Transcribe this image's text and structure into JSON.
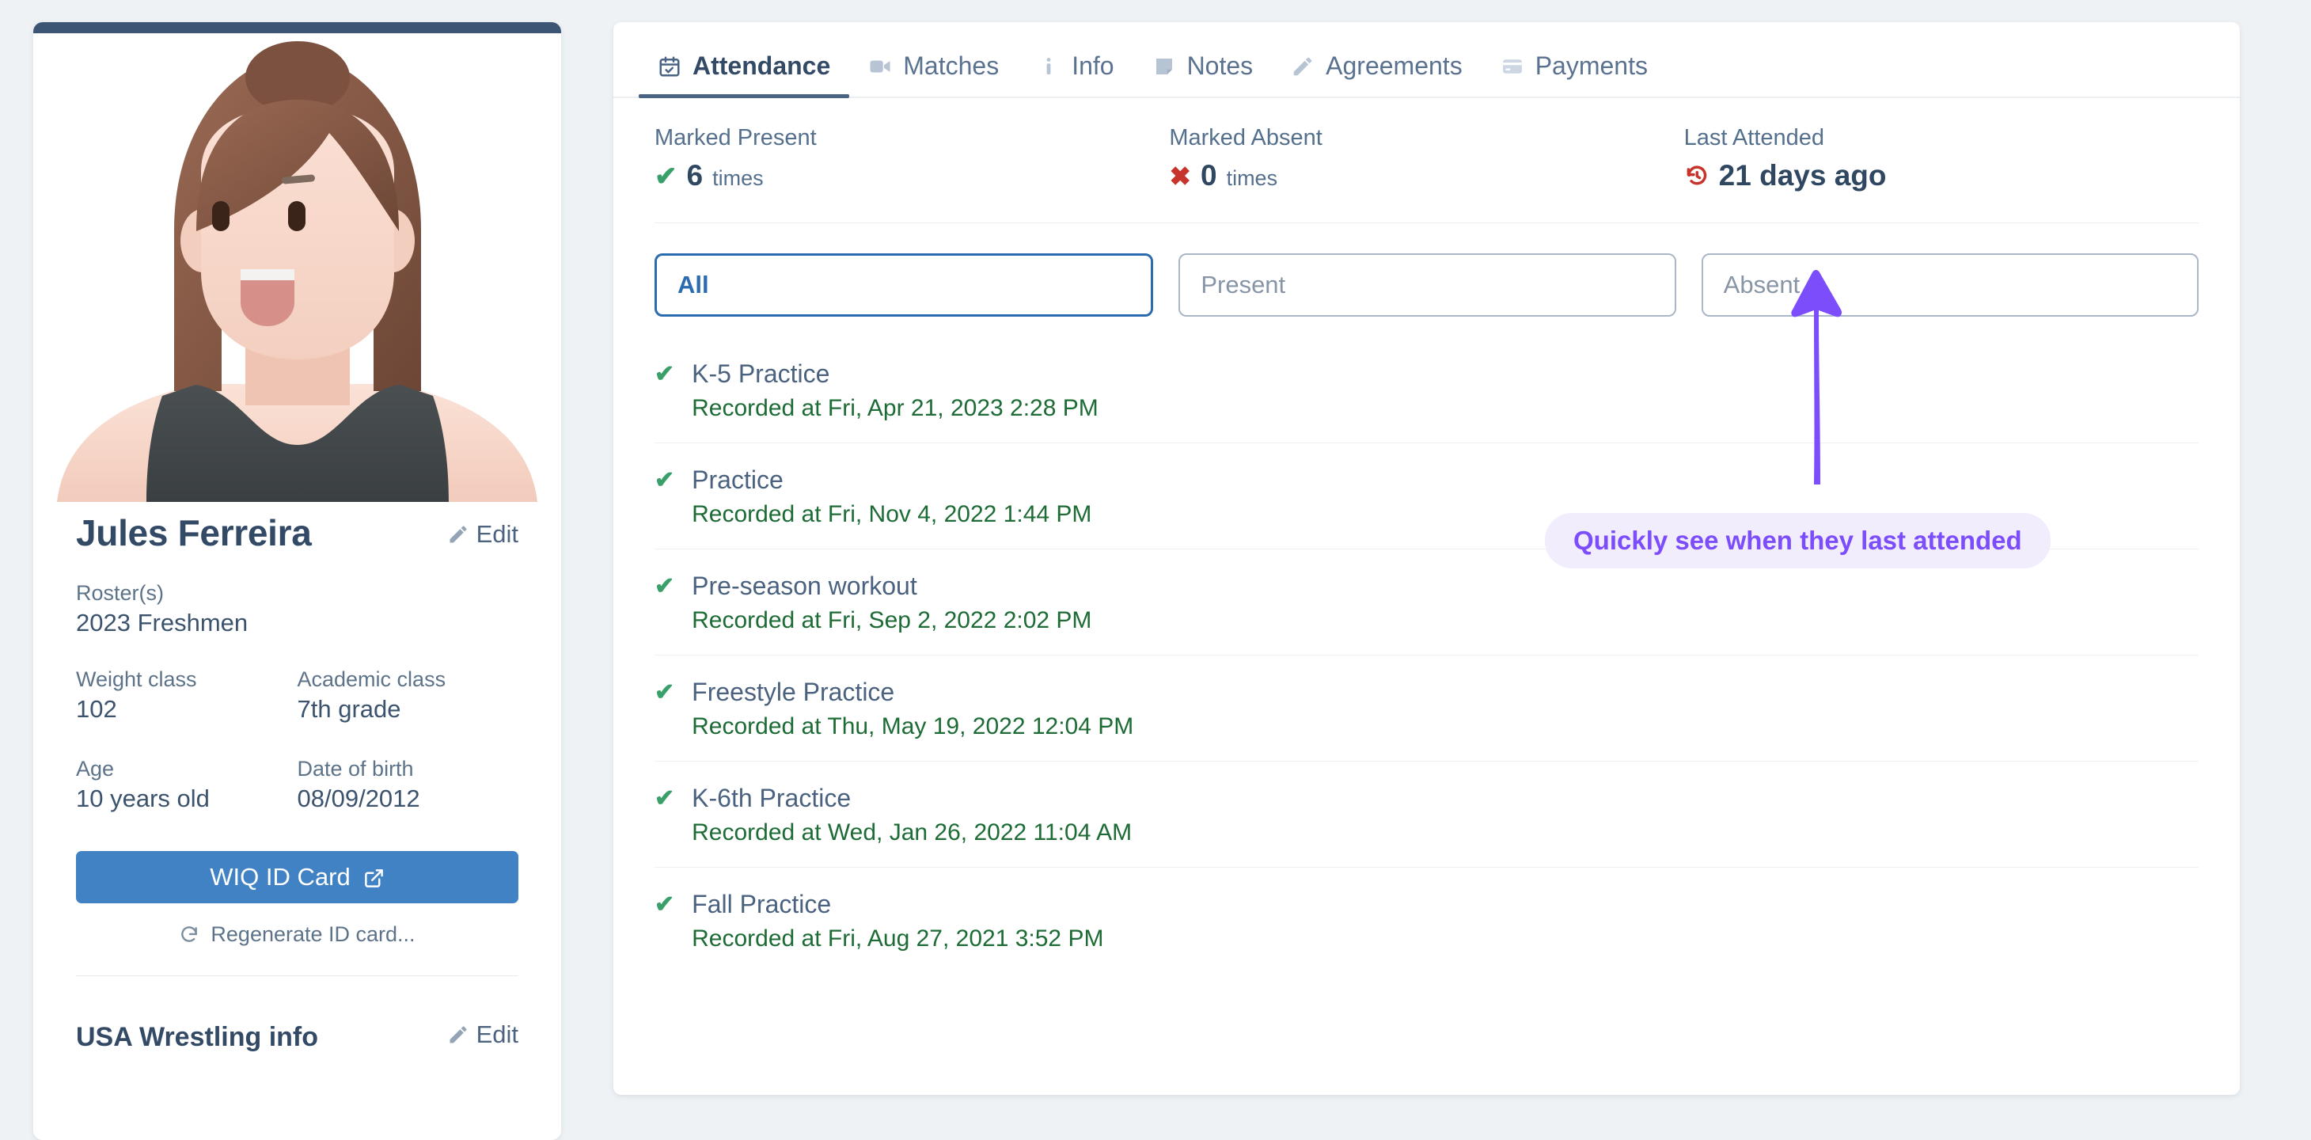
{
  "profile": {
    "name": "Jules Ferreira",
    "edit_label": "Edit",
    "avatar_alt": "female-wrestler-avatar",
    "roster_label": "Roster(s)",
    "roster_value": "2023 Freshmen",
    "weight_class_label": "Weight class",
    "weight_class_value": "102",
    "academic_class_label": "Academic class",
    "academic_class_value": "7th grade",
    "age_label": "Age",
    "age_value": "10 years old",
    "dob_label": "Date of birth",
    "dob_value": "08/09/2012",
    "wiq_button_label": "WIQ ID Card",
    "regenerate_label": "Regenerate ID card...",
    "usa_section_title": "USA Wrestling info",
    "usa_edit_label": "Edit"
  },
  "tabs": [
    {
      "label": "Attendance",
      "icon": "calendar-check-icon",
      "active": true
    },
    {
      "label": "Matches",
      "icon": "video-camera-icon",
      "active": false
    },
    {
      "label": "Info",
      "icon": "info-icon",
      "active": false
    },
    {
      "label": "Notes",
      "icon": "note-icon",
      "active": false
    },
    {
      "label": "Agreements",
      "icon": "pencil-icon",
      "active": false
    },
    {
      "label": "Payments",
      "icon": "credit-card-icon",
      "active": false
    }
  ],
  "stats": [
    {
      "label": "Marked Present",
      "icon": "check-icon",
      "value": "6",
      "unit": "times"
    },
    {
      "label": "Marked Absent",
      "icon": "x-icon",
      "value": "0",
      "unit": "times"
    },
    {
      "label": "Last Attended",
      "icon": "history-clock-icon",
      "value": "21 days ago",
      "unit": ""
    }
  ],
  "filters": [
    {
      "label": "All",
      "selected": true
    },
    {
      "label": "Present",
      "selected": false
    },
    {
      "label": "Absent",
      "selected": false
    }
  ],
  "attendance": [
    {
      "status": "present",
      "title": "K-5 Practice",
      "recorded": "Recorded at Fri, Apr 21, 2023 2:28 PM"
    },
    {
      "status": "present",
      "title": "Practice",
      "recorded": "Recorded at Fri, Nov 4, 2022 1:44 PM"
    },
    {
      "status": "present",
      "title": "Pre-season workout",
      "recorded": "Recorded at Fri, Sep 2, 2022 2:02 PM"
    },
    {
      "status": "present",
      "title": "Freestyle Practice",
      "recorded": "Recorded at Thu, May 19, 2022 12:04 PM"
    },
    {
      "status": "present",
      "title": "K-6th Practice",
      "recorded": "Recorded at Wed, Jan 26, 2022 11:04 AM"
    },
    {
      "status": "present",
      "title": "Fall Practice",
      "recorded": "Recorded at Fri, Aug 27, 2021 3:52 PM"
    }
  ],
  "annotation": {
    "callout_text": "Quickly see when they last attended",
    "arrow": "up-arrow-annotation"
  },
  "colors": {
    "page_background": "#eef2f5",
    "card_top_bar": "#3d5575",
    "primary_button": "#4182c4",
    "accent_blue": "#2b6cb0",
    "present_green": "#3aa06a",
    "recorded_green": "#1d6b35",
    "absent_red": "#c7342b",
    "annotation_purple": "#7c4dfa",
    "annotation_pill_bg": "#f2edfd",
    "heading_navy": "#334a66"
  }
}
